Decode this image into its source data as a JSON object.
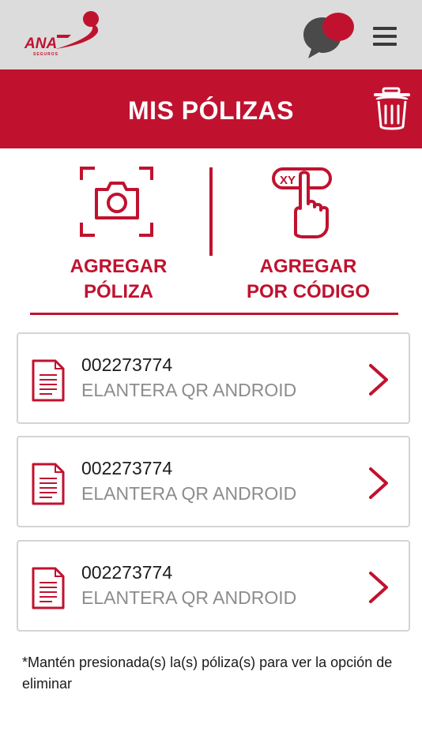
{
  "header": {
    "logo_text": "ANA",
    "logo_subtext": "SEGUROS",
    "logo_mark": "®",
    "chat_icon": "chat-bubbles-icon",
    "menu_icon": "hamburger-menu-icon"
  },
  "title_bar": {
    "title": "MIS PÓLIZAS",
    "trash_icon": "trash-icon"
  },
  "actions": {
    "add_policy": {
      "line1": "AGREGAR",
      "line2": "PÓLIZA",
      "icon": "camera-scan-icon"
    },
    "add_by_code": {
      "line1": "AGREGAR",
      "line2": "POR CÓDIGO",
      "icon": "tap-code-icon",
      "code_text": "XY"
    }
  },
  "policies": [
    {
      "number": "002273774",
      "name": "ELANTERA QR ANDROID"
    },
    {
      "number": "002273774",
      "name": "ELANTERA QR ANDROID"
    },
    {
      "number": "002273774",
      "name": "ELANTERA QR ANDROID"
    }
  ],
  "footnote": "*Mantén presionada(s) la(s) póliza(s) para ver la opción de eliminar",
  "colors": {
    "brand_red": "#c0122f",
    "top_bar_gray": "#dcdcdc",
    "chat_gray": "#4a4a4a"
  }
}
